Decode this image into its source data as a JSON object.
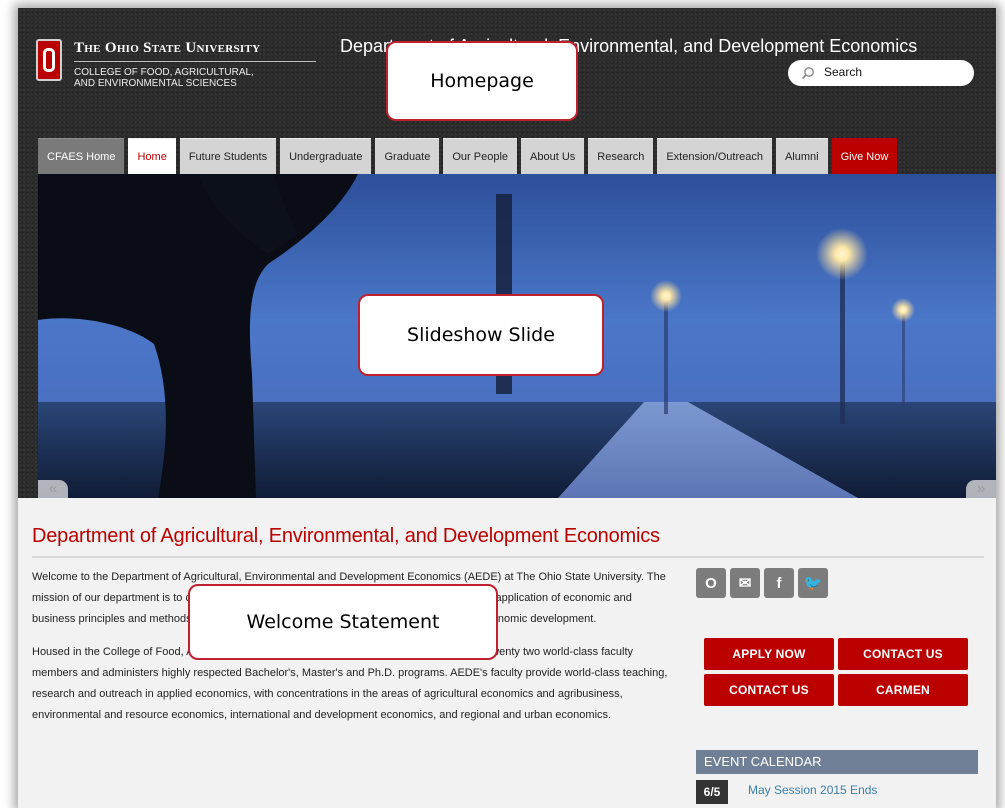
{
  "header": {
    "university_name": "The Ohio State University",
    "college_line1": "COLLEGE OF FOOD, AGRICULTURAL,",
    "college_line2": "AND ENVIRONMENTAL SCIENCES",
    "department_title": "Department of Agricultural, Environmental, and Development Economics",
    "search_placeholder": "Search"
  },
  "nav": {
    "items": [
      {
        "label": "CFAES Home"
      },
      {
        "label": "Home"
      },
      {
        "label": "Future Students"
      },
      {
        "label": "Undergraduate"
      },
      {
        "label": "Graduate"
      },
      {
        "label": "Our People"
      },
      {
        "label": "About Us"
      },
      {
        "label": "Research"
      },
      {
        "label": "Extension/Outreach"
      },
      {
        "label": "Alumni"
      },
      {
        "label": "Give Now"
      }
    ],
    "active": "Home"
  },
  "slideshow": {
    "prev_arrow": "«",
    "next_arrow": "»"
  },
  "main": {
    "heading": "Department of Agricultural, Environmental, and Development Economics",
    "paragraph1": "Welcome to the Department of Agricultural, Environmental and Development Economics (AEDE) at The Ohio State University.  The mission of our department is to create and disseminate knowledge and information through the application of economic and business principles and methods to issues related to the food system, the environment, and economic development.",
    "paragraph2": "Housed in the College of Food, Agricultural and Environmental Sciences, AEDE currently has twenty two world-class faculty members and administers highly respected Bachelor's, Master's and Ph.D. programs. AEDE's faculty provide world-class teaching, research and outreach in applied economics, with concentrations in the areas of agricultural economics and agribusiness, environmental and resource economics, international and development economics, and regional and urban economics."
  },
  "sidebar": {
    "social": [
      {
        "name": "osu-block-o-icon",
        "glyph": "O"
      },
      {
        "name": "email-icon",
        "glyph": "✉"
      },
      {
        "name": "facebook-icon",
        "glyph": "f"
      },
      {
        "name": "twitter-icon",
        "glyph": "🐦"
      }
    ],
    "buttons": [
      "APPLY NOW",
      "CONTACT US",
      "CONTACT US",
      "CARMEN"
    ],
    "event_calendar_title": "EVENT CALENDAR",
    "events": [
      {
        "date": "6/5",
        "title": "May Session 2015 Ends"
      }
    ]
  },
  "annotations": {
    "homepage": "Homepage",
    "slideshow": "Slideshow Slide",
    "welcome": "Welcome Statement"
  },
  "colors": {
    "osu_scarlet": "#bb0000",
    "header_dark": "#2c2c2c",
    "event_header": "#6f8096",
    "link_blue": "#3a7fa8",
    "callout_border": "#c0202e"
  }
}
